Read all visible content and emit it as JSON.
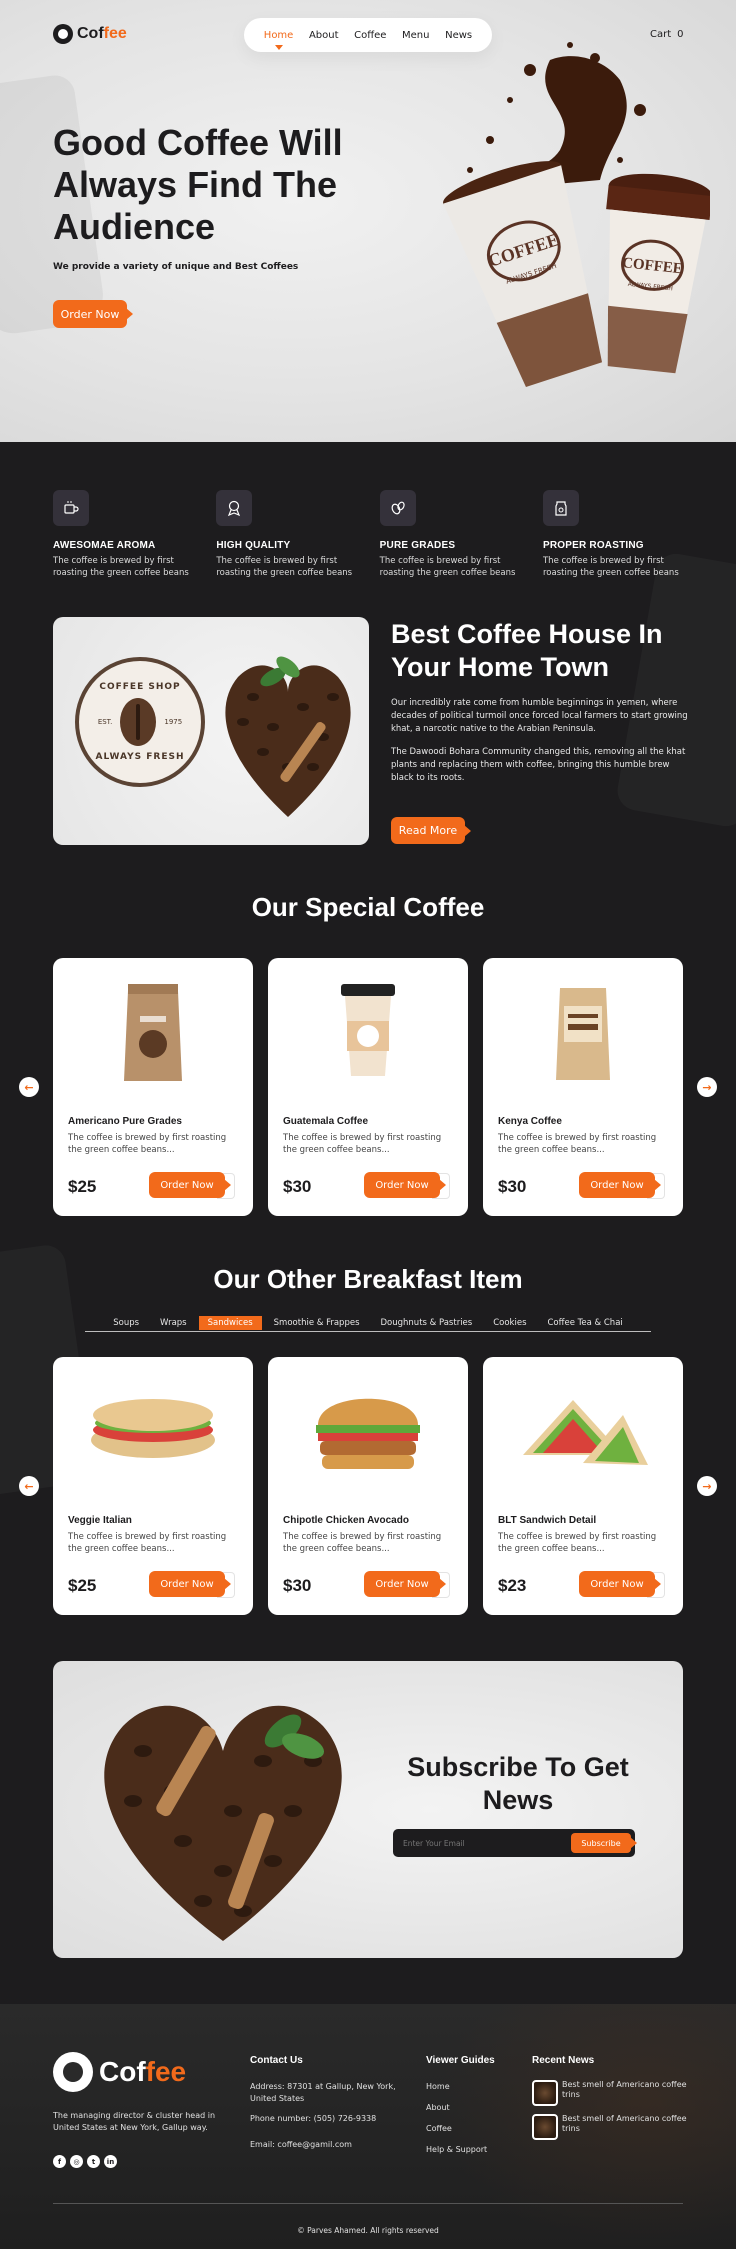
{
  "header": {
    "logo_prefix": "Cof",
    "logo_accent": "fee",
    "nav": [
      "Home",
      "About",
      "Coffee",
      "Menu",
      "News"
    ],
    "cart_label": "Cart",
    "cart_count": "0"
  },
  "hero": {
    "title": "Good Coffee Will Always Find The Audience",
    "subtitle": "We provide a variety of unique and Best Coffees",
    "cta": "Order Now",
    "cup_brand": "COFFEE",
    "cup_tag": "ALWAYS FRESH"
  },
  "features": [
    {
      "title": "AWESOMAE AROMA",
      "desc": "The coffee is brewed by first roasting the green coffee beans",
      "icon": "coffee-cup-icon"
    },
    {
      "title": "HIGH QUALITY",
      "desc": "The coffee is brewed by first roasting the green coffee beans",
      "icon": "quality-badge-icon"
    },
    {
      "title": "PURE GRADES",
      "desc": "The coffee is brewed by first roasting the green coffee beans",
      "icon": "coffee-beans-icon"
    },
    {
      "title": "PROPER ROASTING",
      "desc": "The coffee is brewed by first roasting the green coffee beans",
      "icon": "coffee-bag-icon"
    }
  ],
  "about": {
    "title": "Best Coffee House In Your Home Town",
    "p1": "Our incredibly rate come from humble beginnings in yemen, where decades of political turmoil once forced local farmers to start growing khat, a narcotic native to the Arabian Peninsula.",
    "p2": "The Dawoodi Bohara Community changed this, removing all the khat plants and replacing them with coffee, bringing this humble brew black to its roots.",
    "cta": "Read More",
    "badge_top": "COFFEE SHOP",
    "badge_est": "EST.",
    "badge_year": "1975",
    "badge_bottom": "ALWAYS FRESH"
  },
  "special": {
    "title": "Our Special Coffee",
    "items": [
      {
        "name": "Americano Pure Grades",
        "desc": "The coffee is brewed by first roasting the green coffee beans...",
        "price": "$25",
        "cta": "Order Now"
      },
      {
        "name": "Guatemala Coffee",
        "desc": "The coffee is brewed by first roasting the green coffee beans...",
        "price": "$30",
        "cta": "Order Now"
      },
      {
        "name": "Kenya Coffee",
        "desc": "The coffee is brewed by first roasting the green coffee beans...",
        "price": "$30",
        "cta": "Order Now"
      }
    ]
  },
  "breakfast": {
    "title": "Our Other Breakfast Item",
    "tabs": [
      "Soups",
      "Wraps",
      "Sandwices",
      "Smoothie & Frappes",
      "Doughnuts & Pastries",
      "Cookies",
      "Coffee Tea & Chai"
    ],
    "active_tab": "Sandwices",
    "items": [
      {
        "name": "Veggie Italian",
        "desc": "The coffee is brewed by first roasting the green coffee beans...",
        "price": "$25",
        "cta": "Order Now"
      },
      {
        "name": "Chipotle Chicken Avocado",
        "desc": "The coffee is brewed by first roasting the green coffee beans...",
        "price": "$30",
        "cta": "Order Now"
      },
      {
        "name": "BLT Sandwich Detail",
        "desc": "The coffee is brewed by first roasting the green coffee beans...",
        "price": "$23",
        "cta": "Order Now"
      }
    ]
  },
  "subscribe": {
    "title": "Subscribe To Get News",
    "placeholder": "Enter Your Email",
    "button": "Subscribe"
  },
  "footer": {
    "description": "The managing director & cluster head in United States at New York, Gallup way.",
    "contact_title": "Contact Us",
    "address": "Address: 87301 at Gallup, New York, United States",
    "phone": "Phone number: (505) 726-9338",
    "email": "Email: coffee@gamil.com",
    "guides_title": "Viewer Guides",
    "guides": [
      "Home",
      "About",
      "Coffee",
      "Help & Support"
    ],
    "news_title": "Recent News",
    "news": [
      {
        "title": "Best smell of Americano coffee trins"
      },
      {
        "title": "Best smell of Americano coffee trins"
      }
    ],
    "social_icons": [
      "facebook-icon",
      "instagram-icon",
      "twitter-icon",
      "linkedin-icon"
    ],
    "copyright": "© Parves Ahamed. All rights reserved"
  },
  "colors": {
    "accent": "#f26a1b",
    "dark": "#1d1c1e",
    "light": "#ffffff"
  }
}
